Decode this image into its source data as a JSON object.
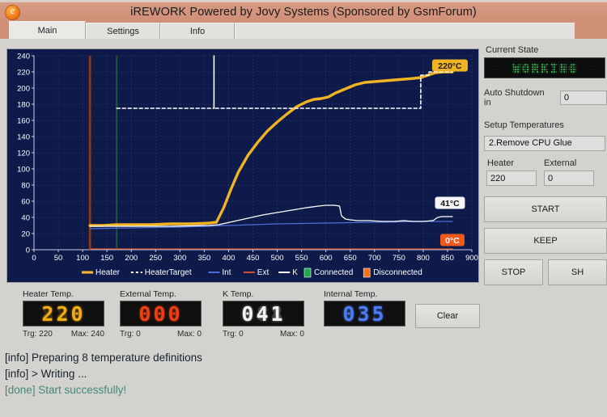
{
  "window": {
    "title": "iREWORK Powered by Jovy Systems (Sponsored by GsmForum)",
    "icon": "app-logo-icon",
    "titlebar_color": "#d4937c"
  },
  "tabs": [
    {
      "label": "Main",
      "active": true
    },
    {
      "label": "Settings",
      "active": false
    },
    {
      "label": "Info",
      "active": false
    }
  ],
  "chart_data": {
    "type": "line",
    "title": "",
    "xlabel": "",
    "ylabel": "",
    "xlim": [
      0,
      900
    ],
    "ylim": [
      0,
      240
    ],
    "xticks": [
      0,
      50,
      100,
      150,
      200,
      250,
      300,
      350,
      400,
      450,
      500,
      550,
      600,
      650,
      700,
      750,
      800,
      850,
      900
    ],
    "yticks": [
      0,
      20,
      40,
      60,
      80,
      100,
      120,
      140,
      160,
      180,
      200,
      220,
      240
    ],
    "grid": true,
    "background": "#0e1a4a",
    "legend_position": "bottom",
    "legend": [
      {
        "name": "Heater",
        "color": "#f0b323",
        "style": "solid"
      },
      {
        "name": "HeaterTarget",
        "color": "#ffffff",
        "style": "dashed"
      },
      {
        "name": "Int",
        "color": "#4b6ed6",
        "style": "solid"
      },
      {
        "name": "Ext",
        "color": "#d2502a",
        "style": "solid"
      },
      {
        "name": "K",
        "color": "#ffffff",
        "style": "solid"
      },
      {
        "name": "Connected",
        "color": "#1faa4b",
        "style": "swatch"
      },
      {
        "name": "Disconnected",
        "color": "#f2711c",
        "style": "swatch"
      }
    ],
    "markers": [
      {
        "name": "event-line-orange",
        "x": 115,
        "color": "#9a3b12"
      },
      {
        "name": "event-line-green",
        "x": 170,
        "color": "#2b6b3f"
      }
    ],
    "annotations": [
      {
        "name": "heater-value-label",
        "text": "220°C",
        "x": 855,
        "y": 228,
        "bg": "#f0b323",
        "fg": "#1a1a1a"
      },
      {
        "name": "k-value-label",
        "text": "41°C",
        "x": 855,
        "y": 58,
        "bg": "#f4f4f4",
        "fg": "#151515"
      },
      {
        "name": "ext-value-label",
        "text": "0°C",
        "x": 860,
        "y": 12,
        "bg": "#f2591c",
        "fg": "#ffffff"
      }
    ],
    "series": [
      {
        "name": "Heater",
        "color": "#f0b323",
        "style": "solid",
        "points": [
          [
            115,
            30
          ],
          [
            140,
            30
          ],
          [
            170,
            31
          ],
          [
            200,
            31
          ],
          [
            240,
            31
          ],
          [
            280,
            32
          ],
          [
            320,
            32
          ],
          [
            360,
            33
          ],
          [
            375,
            34
          ],
          [
            390,
            52
          ],
          [
            405,
            75
          ],
          [
            420,
            96
          ],
          [
            440,
            117
          ],
          [
            460,
            133
          ],
          [
            480,
            147
          ],
          [
            500,
            158
          ],
          [
            520,
            168
          ],
          [
            540,
            177
          ],
          [
            560,
            183
          ],
          [
            575,
            186
          ],
          [
            590,
            187
          ],
          [
            605,
            189
          ],
          [
            620,
            194
          ],
          [
            640,
            199
          ],
          [
            660,
            204
          ],
          [
            680,
            207
          ],
          [
            700,
            208
          ],
          [
            720,
            209
          ],
          [
            740,
            210
          ],
          [
            760,
            211
          ],
          [
            780,
            212
          ],
          [
            795,
            213
          ],
          [
            810,
            216
          ],
          [
            825,
            219
          ],
          [
            840,
            220
          ],
          [
            860,
            220
          ]
        ]
      },
      {
        "name": "HeaterTarget",
        "color": "#ffffff",
        "style": "dashed",
        "points": [
          [
            170,
            175
          ],
          [
            370,
            175
          ],
          [
            370,
            240
          ],
          [
            370,
            175
          ],
          [
            500,
            175
          ],
          [
            640,
            175
          ],
          [
            795,
            175
          ],
          [
            795,
            216
          ],
          [
            812,
            216
          ],
          [
            812,
            220
          ],
          [
            860,
            220
          ]
        ]
      },
      {
        "name": "Int",
        "color": "#4b6ed6",
        "style": "solid",
        "points": [
          [
            115,
            26
          ],
          [
            200,
            27
          ],
          [
            300,
            28
          ],
          [
            400,
            30
          ],
          [
            500,
            32
          ],
          [
            600,
            33
          ],
          [
            700,
            34
          ],
          [
            800,
            35
          ],
          [
            860,
            35
          ]
        ]
      },
      {
        "name": "Ext",
        "color": "#d2502a",
        "style": "solid",
        "points": [
          [
            115,
            1
          ],
          [
            300,
            1
          ],
          [
            500,
            1
          ],
          [
            700,
            1
          ],
          [
            860,
            1
          ]
        ]
      },
      {
        "name": "K",
        "color": "#ffffff",
        "style": "solid",
        "points": [
          [
            115,
            29
          ],
          [
            200,
            29
          ],
          [
            280,
            29
          ],
          [
            360,
            30
          ],
          [
            380,
            31
          ],
          [
            410,
            35
          ],
          [
            440,
            39
          ],
          [
            470,
            43
          ],
          [
            500,
            46
          ],
          [
            530,
            49
          ],
          [
            560,
            52
          ],
          [
            585,
            54
          ],
          [
            600,
            55
          ],
          [
            618,
            55
          ],
          [
            628,
            54
          ],
          [
            632,
            42
          ],
          [
            640,
            38
          ],
          [
            650,
            37
          ],
          [
            665,
            36
          ],
          [
            690,
            36
          ],
          [
            715,
            35
          ],
          [
            740,
            35
          ],
          [
            760,
            36
          ],
          [
            780,
            35
          ],
          [
            800,
            35
          ],
          [
            820,
            36
          ],
          [
            830,
            40
          ],
          [
            838,
            41
          ],
          [
            860,
            41
          ]
        ]
      }
    ]
  },
  "right_panel": {
    "current_state_label": "Current State",
    "current_state_value": "WORKING",
    "auto_shutdown_label": "Auto Shutdown in",
    "auto_shutdown_value": "0",
    "setup_temperatures_label": "Setup Temperatures",
    "profile_selected": "2.Remove CPU Glue",
    "heater_label": "Heater",
    "heater_value": "220",
    "external_label": "External",
    "external_value": "0",
    "start_button": "START",
    "keep_button": "KEEP",
    "stop_button": "STOP",
    "shutdown_button": "SH"
  },
  "gauges": [
    {
      "name": "heater-temp",
      "caption": "Heater Temp.",
      "value": "220",
      "color_class": "amber",
      "trg_label": "Trg: 220",
      "max_label": "Max: 240"
    },
    {
      "name": "external-temp",
      "caption": "External Temp.",
      "value": "000",
      "color_class": "red",
      "trg_label": "Trg: 0",
      "max_label": "Max: 0"
    },
    {
      "name": "k-temp",
      "caption": "K Temp.",
      "value": "041",
      "color_class": "white",
      "trg_label": "Trg: 0",
      "max_label": "Max: 0"
    },
    {
      "name": "internal-temp",
      "caption": "Internal Temp.",
      "value": "035",
      "color_class": "blue",
      "trg_label": "",
      "max_label": ""
    }
  ],
  "clear_button": "Clear",
  "log": [
    {
      "text": "[info] Preparing 8 temperature definitions",
      "type": "info"
    },
    {
      "text": "[info] > Writing ...",
      "type": "info"
    },
    {
      "text": "[done] Start successfully!",
      "type": "done"
    }
  ]
}
